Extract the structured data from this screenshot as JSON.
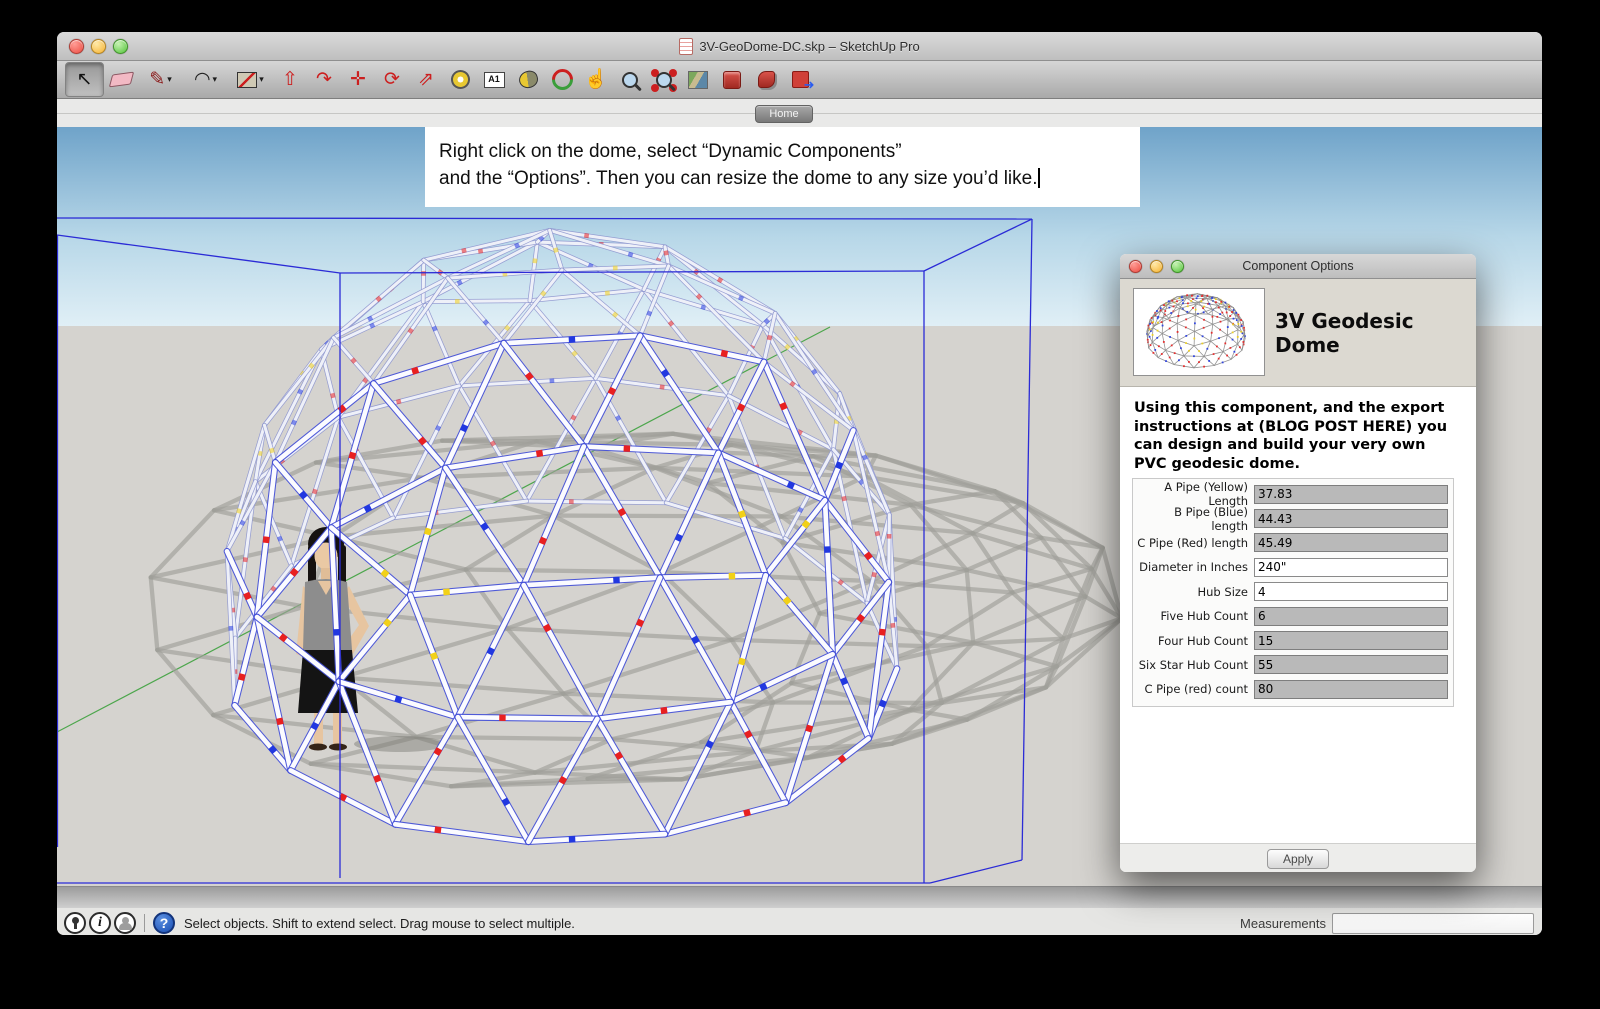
{
  "window": {
    "title": "3V-GeoDome-DC.skp – SketchUp Pro"
  },
  "toolbar": {
    "tools": [
      {
        "name": "select",
        "glyph": "↖",
        "color": "#111111",
        "pressed": true
      },
      {
        "name": "eraser",
        "shape": true
      },
      {
        "name": "line",
        "glyph": "✎",
        "color": "#8b1a1a",
        "caret": true
      },
      {
        "name": "arc",
        "glyph": "◠",
        "color": "#222222",
        "caret": true
      },
      {
        "name": "rectangle",
        "shape": true,
        "caret": true
      },
      {
        "name": "push-pull",
        "glyph": "⇧",
        "color": "#cc1f1f"
      },
      {
        "name": "follow-me",
        "glyph": "↷",
        "color": "#cc1f1f"
      },
      {
        "name": "move",
        "glyph": "✛",
        "color": "#cc1f1f"
      },
      {
        "name": "rotate",
        "glyph": "⟳",
        "color": "#cc1f1f"
      },
      {
        "name": "scale",
        "glyph": "⇗",
        "color": "#cc1f1f"
      },
      {
        "name": "tape-measure",
        "shape": true
      },
      {
        "name": "text",
        "shape": true,
        "glyph": "A1"
      },
      {
        "name": "paint-bucket",
        "shape": true
      },
      {
        "name": "orbit",
        "shape": true
      },
      {
        "name": "pan",
        "glyph": "☝",
        "color": "#1c1c1c"
      },
      {
        "name": "zoom",
        "shape": true
      },
      {
        "name": "zoom-extents",
        "shape": true
      },
      {
        "name": "add-location",
        "shape": true
      },
      {
        "name": "get-models",
        "shape": true
      },
      {
        "name": "share-model",
        "shape": true
      },
      {
        "name": "export",
        "shape": true
      }
    ]
  },
  "tabs": {
    "home_label": "Home"
  },
  "annotation": {
    "line1": "Right click on the dome, select “Dynamic Components”",
    "line2": "and the “Options”. Then you can resize the dome to any size you’d like."
  },
  "dialog": {
    "title": "Component Options",
    "heading": "3V Geodesic Dome",
    "description": "Using this component, and the export instructions at (BLOG POST HERE) you can design and build your very own PVC geodesic dome.",
    "fields": [
      {
        "label": "A Pipe (Yellow) Length",
        "value": "37.83",
        "editable": false
      },
      {
        "label": "B Pipe (Blue) length",
        "value": "44.43",
        "editable": false
      },
      {
        "label": "C Pipe (Red) length",
        "value": "45.49",
        "editable": false
      },
      {
        "label": "Diameter in Inches",
        "value": "240\"",
        "editable": true
      },
      {
        "label": "Hub Size",
        "value": "4",
        "editable": true
      },
      {
        "label": "Five Hub Count",
        "value": "6",
        "editable": false
      },
      {
        "label": "Four Hub Count",
        "value": "15",
        "editable": false
      },
      {
        "label": "Six Star Hub Count",
        "value": "55",
        "editable": false
      },
      {
        "label": "C Pipe (red) count",
        "value": "80",
        "editable": false
      }
    ],
    "apply_label": "Apply"
  },
  "status_bar": {
    "icons": [
      "geolocation",
      "credits",
      "sign-in",
      "help"
    ],
    "message": "Select objects. Shift to extend select. Drag mouse to select multiple.",
    "measurements_label": "Measurements",
    "measurements_value": ""
  },
  "scene": {
    "colors": {
      "sky_top": "#6fa3c9",
      "sky_mid": "#b7d7e8",
      "sky_bottom": "#e0eff6",
      "ground": "#d5d3cf",
      "strut_core": "#fbfbff",
      "strut_edge": "#4450d8",
      "strut_core_back": "#eef0f8",
      "strut_edge_back": "#9098d0",
      "marker_a_yellow": "#f2d118",
      "marker_b_blue": "#2238e0",
      "marker_c_red": "#e82020",
      "shadow": "#a0a09a",
      "selection_box": "#2b2bd6",
      "axis_green": "#4ca64c"
    }
  }
}
